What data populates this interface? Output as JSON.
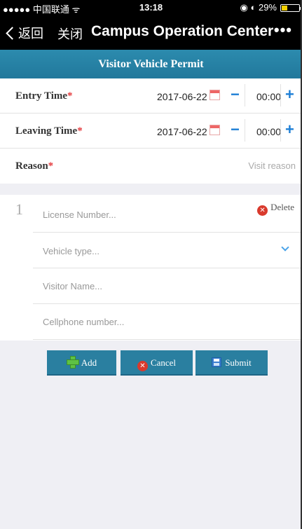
{
  "status_bar": {
    "carrier": "●●●●● 中国联通 ᯤ",
    "time": "13:18",
    "battery_text": "◉ ◐ 29%",
    "battery_color": "#f4d000"
  },
  "nav": {
    "back_label": "返回",
    "close_label": "关闭",
    "title": "Campus Operation Center",
    "more_label": "•••"
  },
  "header": {
    "title": "Visitor Vehicle Permit"
  },
  "form": {
    "entry": {
      "label": "Entry Time",
      "required_mark": "*",
      "date": "2017-06-22",
      "minus": "−",
      "time": "00:00",
      "plus": "+"
    },
    "leaving": {
      "label": "Leaving Time",
      "required_mark": "*",
      "date": "2017-06-22",
      "minus": "−",
      "time": "00:00",
      "plus": "+"
    },
    "reason": {
      "label": "Reason",
      "required_mark": "*",
      "placeholder": "Visit reason"
    }
  },
  "vehicle": {
    "index": "1",
    "delete_label": "Delete",
    "license_placeholder": "License Number...",
    "type_placeholder": "Vehicle type...",
    "name_placeholder": "Visitor Name...",
    "phone_placeholder": "Cellphone number..."
  },
  "actions": {
    "add": "Add",
    "cancel": "Cancel",
    "submit": "Submit"
  },
  "colors": {
    "accent": "#2a7fa0",
    "required": "#e4393c",
    "link_blue": "#1e7fd6",
    "delete_red": "#d93a2d"
  }
}
